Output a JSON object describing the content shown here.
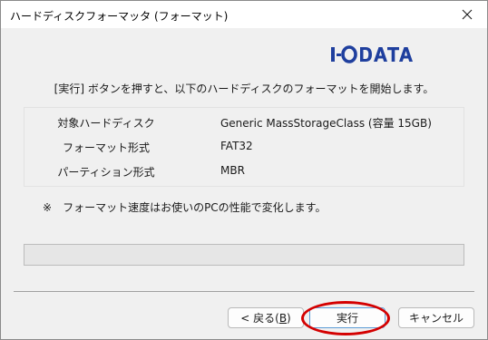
{
  "window": {
    "title": "ハードディスクフォーマッタ (フォーマット)",
    "close_glyph": "✕"
  },
  "brand": {
    "logo_text": "I·O DATA",
    "color": "#1f3f9e"
  },
  "instruction": "[実行] ボタンを押すと、以下のハードディスクのフォーマットを開始します。",
  "info": [
    {
      "label": "対象ハードディスク",
      "value": "Generic MassStorageClass (容量 15GB)"
    },
    {
      "label": "フォーマット形式",
      "value": "FAT32"
    },
    {
      "label": "パーティション形式",
      "value": "MBR"
    }
  ],
  "note": {
    "mark": "※",
    "text": "フォーマット速度はお使いのPCの性能で変化します。"
  },
  "progress": {
    "value_percent": 0
  },
  "buttons": {
    "back": {
      "label": "< 戻る(",
      "mnemonic": "B",
      "suffix": ")"
    },
    "execute": {
      "label": "実行"
    },
    "cancel": {
      "label": "キャンセル"
    }
  },
  "annotation": {
    "highlight_color": "#d40000"
  }
}
